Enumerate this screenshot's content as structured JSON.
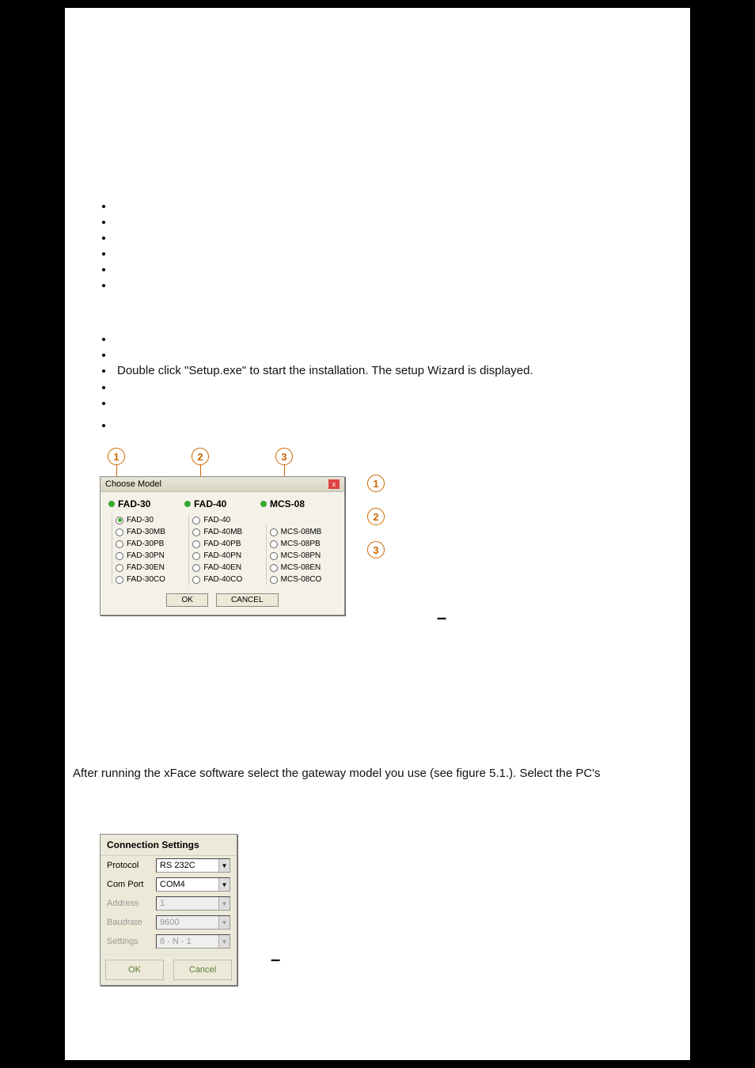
{
  "setup_bullet_text": "Double click \"Setup.exe\" to start the installation. The setup Wizard is displayed.",
  "callouts_top": [
    "1",
    "2",
    "3"
  ],
  "callouts_right": [
    "1",
    "2",
    "3"
  ],
  "dialog1": {
    "title": "Choose Model",
    "close": "x",
    "headers": [
      "FAD-30",
      "FAD-40",
      "MCS-08"
    ],
    "col1": [
      "FAD-30",
      "FAD-30MB",
      "FAD-30PB",
      "FAD-30PN",
      "FAD-30EN",
      "FAD-30CO"
    ],
    "col1_selected": 0,
    "col2": [
      "FAD-40",
      "FAD-40MB",
      "FAD-40PB",
      "FAD-40PN",
      "FAD-40EN",
      "FAD-40CO"
    ],
    "col3": [
      "",
      "MCS-08MB",
      "MCS-08PB",
      "MCS-08PN",
      "MCS-08EN",
      "MCS-08CO"
    ],
    "ok": "OK",
    "cancel": "CANCEL"
  },
  "dash": "–",
  "paragraph": "After running the xFace software select the gateway model you use (see figure 5.1.). Select the PC's",
  "dialog2": {
    "title": "Connection Settings",
    "rows": [
      {
        "label": "Protocol",
        "value": "RS 232C",
        "disabled": false
      },
      {
        "label": "Com Port",
        "value": "COM4",
        "disabled": false
      },
      {
        "label": "Address",
        "value": "1",
        "disabled": true
      },
      {
        "label": "Baudrate",
        "value": "9600",
        "disabled": true
      },
      {
        "label": "Settings",
        "value": "8 - N - 1",
        "disabled": true
      }
    ],
    "ok": "OK",
    "cancel": "Cancel"
  }
}
